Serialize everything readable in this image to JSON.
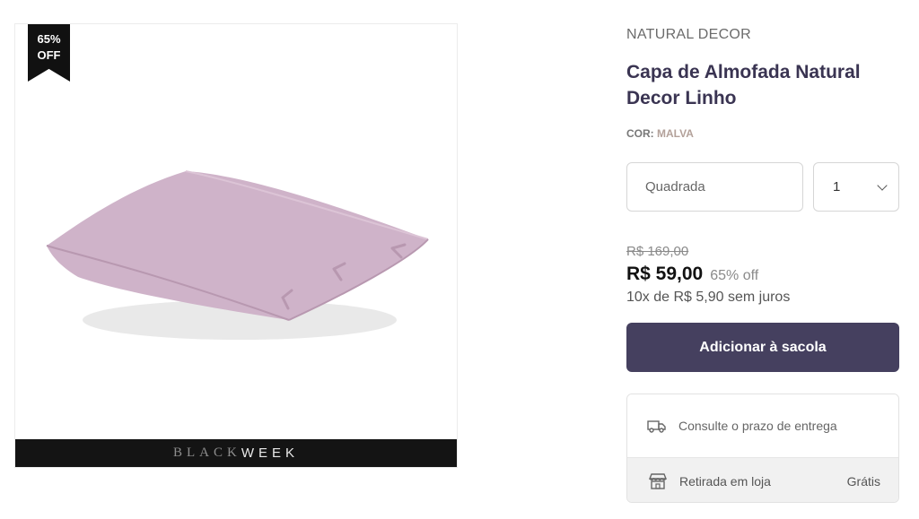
{
  "product_image": {
    "discount_badge": {
      "percent": "65%",
      "label": "OFF"
    },
    "banner": {
      "word1": "BLACK",
      "word2": "WEEK"
    },
    "pillow_color": "#cfb3c9"
  },
  "product": {
    "brand": "NATURAL DECOR",
    "title": "Capa de Almofada Natural Decor Linho",
    "color_label": "COR:",
    "color_value": "MALVA"
  },
  "options": {
    "size_value": "Quadrada",
    "quantity_value": "1"
  },
  "pricing": {
    "old_price": "R$ 169,00",
    "price": "R$ 59,00",
    "discount": "65% off",
    "installments": "10x de R$ 5,90 sem juros"
  },
  "cart": {
    "add_label": "Adicionar à sacola"
  },
  "shipping": {
    "delivery_label": "Consulte o prazo de entrega",
    "pickup_label": "Retirada em loja",
    "pickup_price": "Grátis"
  },
  "colors": {
    "accent": "#45405f",
    "title": "#3a3452"
  }
}
